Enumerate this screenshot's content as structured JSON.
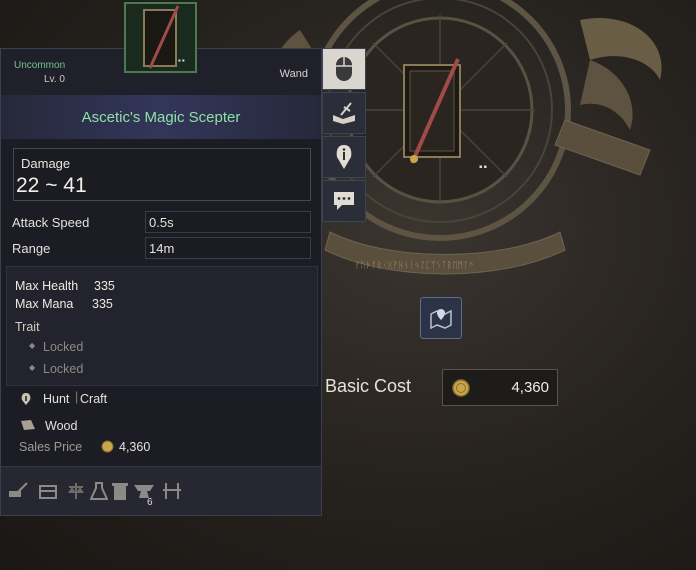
{
  "item": {
    "rarity": "Uncommon",
    "level": "Lv. 0",
    "type": "Wand",
    "name": "Ascetic's Magic Scepter",
    "thumb_dots": "▪▪"
  },
  "damage": {
    "label": "Damage",
    "value": "22 ~ 41"
  },
  "stats": [
    {
      "label": "Attack Speed",
      "value": "0.5s"
    },
    {
      "label": "Range",
      "value": "14m"
    }
  ],
  "bonus": {
    "max_health_label": "Max Health",
    "max_health_value": "335",
    "max_mana_label": "Max Mana",
    "max_mana_value": "335",
    "trait_label": "Trait",
    "trait_slots": [
      "Locked",
      "Locked"
    ]
  },
  "source": {
    "hunt": "Hunt",
    "craft": "Craft"
  },
  "material": "Wood",
  "sales": {
    "label": "Sales Price",
    "value": "4,360"
  },
  "action_bar": {
    "count_badge": "6"
  },
  "side_tabs": [
    "mouse-icon",
    "book-sword-icon",
    "info-icon",
    "chat-icon"
  ],
  "basic_cost": {
    "label": "Basic Cost",
    "value": "4,360"
  },
  "center_dots": "▪▪",
  "colors": {
    "uncommon_green": "#6fc68a",
    "name_green": "#8fe0a4",
    "panel_bg": "#1c1d24",
    "gold": "#c9a64a"
  }
}
